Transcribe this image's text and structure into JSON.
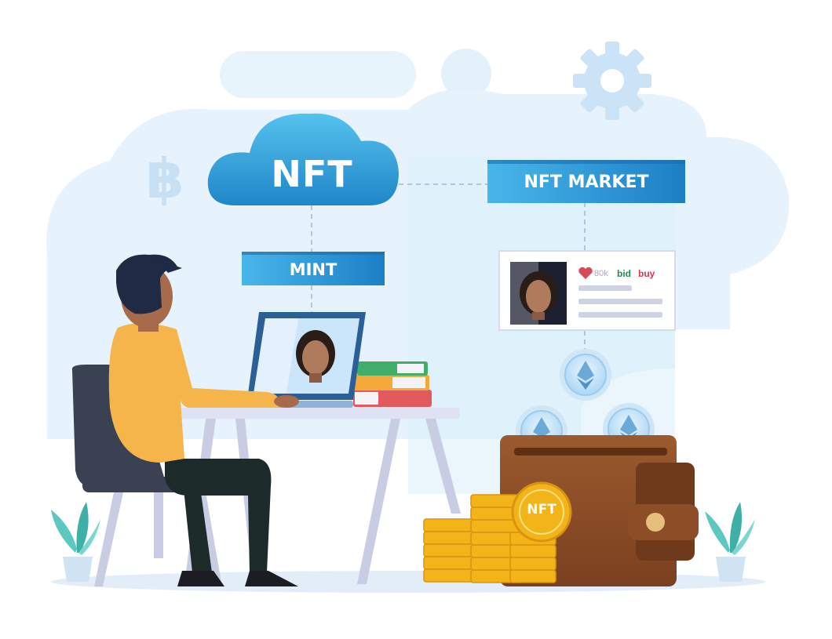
{
  "cloud": {
    "label": "NFT"
  },
  "market": {
    "label": "NFT MARKET"
  },
  "mint": {
    "label": "MINT"
  },
  "card": {
    "likes": "80k",
    "bid": "bid",
    "buy": "buy"
  },
  "coin": {
    "label": "NFT"
  },
  "colors": {
    "cloud_blue": "#2f9ed8",
    "banner_blue": "#2b8fd6",
    "shirt": "#f6b54a",
    "hair": "#1f2a44",
    "chair": "#3a4152",
    "wallet": "#8b4d26",
    "gold": "#f2b418",
    "backdrop": "#e6f3fc"
  },
  "icons": [
    "bitcoin-icon",
    "gear-icon",
    "heart-icon",
    "ethereum-icon"
  ]
}
